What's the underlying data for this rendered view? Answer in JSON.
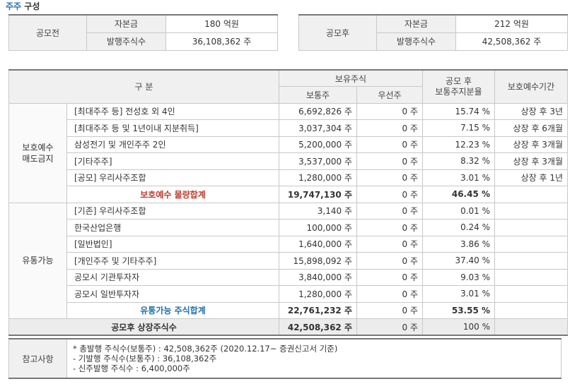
{
  "title": {
    "part1": "주주",
    "part2": "구성"
  },
  "capital": {
    "before": {
      "header": "공모전",
      "rows": [
        {
          "label": "자본금",
          "value": "180 억원"
        },
        {
          "label": "발행주식수",
          "value": "36,108,362 주"
        }
      ]
    },
    "after": {
      "header": "공모후",
      "rows": [
        {
          "label": "자본금",
          "value": "212 억원"
        },
        {
          "label": "발행주식수",
          "value": "42,508,362 주"
        }
      ]
    }
  },
  "table": {
    "headers": {
      "category": "구 분",
      "holdings": "보유주식",
      "common": "보통주",
      "preferred": "우선주",
      "ratio_line1": "공모 후",
      "ratio_line2": "보통주지분율",
      "lockup": "보호예수기간"
    },
    "groups": [
      {
        "label_line1": "보호예수",
        "label_line2": "매도금지",
        "rows": [
          {
            "name": "[최대주주 등] 전성호 외 4인",
            "common": "6,692,826 주",
            "preferred": "0 주",
            "ratio": "15.74 %",
            "lockup": "상장 후 3년"
          },
          {
            "name": "[최대주주 등 및 1년이내 지분취득]",
            "common": "3,037,304 주",
            "preferred": "0 주",
            "ratio": "7.15 %",
            "lockup": "상장 후 6개월"
          },
          {
            "name": "삼성전기 및 개인주주 2인",
            "common": "5,200,000 주",
            "preferred": "0 주",
            "ratio": "12.23 %",
            "lockup": "상장 후 3개월"
          },
          {
            "name": "[기타주주]",
            "common": "3,537,000 주",
            "preferred": "0 주",
            "ratio": "8.32 %",
            "lockup": "상장 후 3개월"
          },
          {
            "name": "[공모] 우리사주조합",
            "common": "1,280,000 주",
            "preferred": "0 주",
            "ratio": "3.01 %",
            "lockup": "상장 후 1년"
          }
        ],
        "subtotal": {
          "name": "보호예수 물량합계",
          "common": "19,747,130 주",
          "preferred": "0 주",
          "ratio": "46.45 %",
          "lockup": ""
        }
      },
      {
        "label_line1": "유통가능",
        "label_line2": "",
        "rows": [
          {
            "name": "[기존] 우리사주조합",
            "common": "3,140 주",
            "preferred": "0 주",
            "ratio": "0.01 %",
            "lockup": ""
          },
          {
            "name": "한국산업은행",
            "common": "100,000 주",
            "preferred": "0 주",
            "ratio": "0.24 %",
            "lockup": ""
          },
          {
            "name": "[일반법인]",
            "common": "1,640,000 주",
            "preferred": "0 주",
            "ratio": "3.86 %",
            "lockup": ""
          },
          {
            "name": "[개인주주 및 기타주주]",
            "common": "15,898,092 주",
            "preferred": "0 주",
            "ratio": "37.40 %",
            "lockup": ""
          },
          {
            "name": "공모시 기관투자자",
            "common": "3,840,000 주",
            "preferred": "0 주",
            "ratio": "9.03 %",
            "lockup": ""
          },
          {
            "name": "공모시 일반투자자",
            "common": "1,280,000 주",
            "preferred": "0 주",
            "ratio": "3.01 %",
            "lockup": ""
          }
        ],
        "subtotal": {
          "name": "유통가능 주식합계",
          "common": "22,761,232 주",
          "preferred": "0 주",
          "ratio": "53.55 %",
          "lockup": ""
        }
      }
    ],
    "total": {
      "name": "공모후 상장주식수",
      "common": "42,508,362 주",
      "preferred": "0 주",
      "ratio": "100 %",
      "lockup": ""
    }
  },
  "notes": {
    "header": "참고사항",
    "lines": [
      "* 총발행 주식수(보통주) : 42,508,362주 (2020.12.17~ 증권신고서 기준)",
      "- 기발행 주식수(보통주) : 36,108,362주",
      "- 신주발행 주식수 : 6,400,000주"
    ]
  }
}
